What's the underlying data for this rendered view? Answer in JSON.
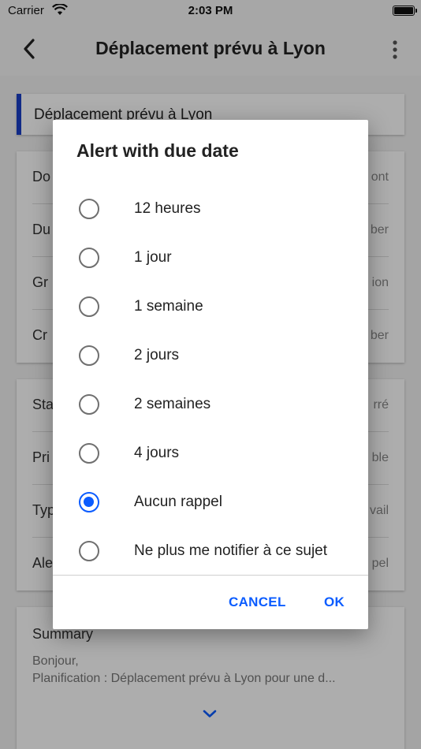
{
  "status_bar": {
    "carrier": "Carrier",
    "time": "2:03 PM"
  },
  "app_bar": {
    "title": "Déplacement prévu à Lyon",
    "back_icon": "chevron-left-icon",
    "menu_icon": "more-vert-icon"
  },
  "background": {
    "title_card": "Déplacement prévu à Lyon",
    "details_rows": [
      {
        "label": "Do",
        "value": "ont"
      },
      {
        "label": "Du",
        "value": "ber"
      },
      {
        "label": "Gr",
        "value": "ion"
      },
      {
        "label": "Cr",
        "value": "ber"
      }
    ],
    "status_rows": [
      {
        "label": "Sta",
        "value": "rré"
      },
      {
        "label": "Pri",
        "value": "ble"
      },
      {
        "label": "Typ",
        "value": "vail"
      },
      {
        "label": "Ale",
        "value": "pel"
      }
    ],
    "summary": {
      "title": "Summary",
      "line1": "Bonjour,",
      "line2": "Planification : Déplacement prévu à Lyon pour une d..."
    }
  },
  "dialog": {
    "title": "Alert with due date",
    "options": [
      {
        "label": "12 heures",
        "checked": false
      },
      {
        "label": "1 jour",
        "checked": false
      },
      {
        "label": "1 semaine",
        "checked": false
      },
      {
        "label": "2 jours",
        "checked": false
      },
      {
        "label": "2 semaines",
        "checked": false
      },
      {
        "label": "4 jours",
        "checked": false
      },
      {
        "label": "Aucun rappel",
        "checked": true
      },
      {
        "label": "Ne plus me notifier à ce sujet",
        "checked": false
      }
    ],
    "cancel_label": "CANCEL",
    "ok_label": "OK"
  },
  "colors": {
    "accent": "#0b5cff",
    "title_bar_accent": "#1a3ec7"
  }
}
